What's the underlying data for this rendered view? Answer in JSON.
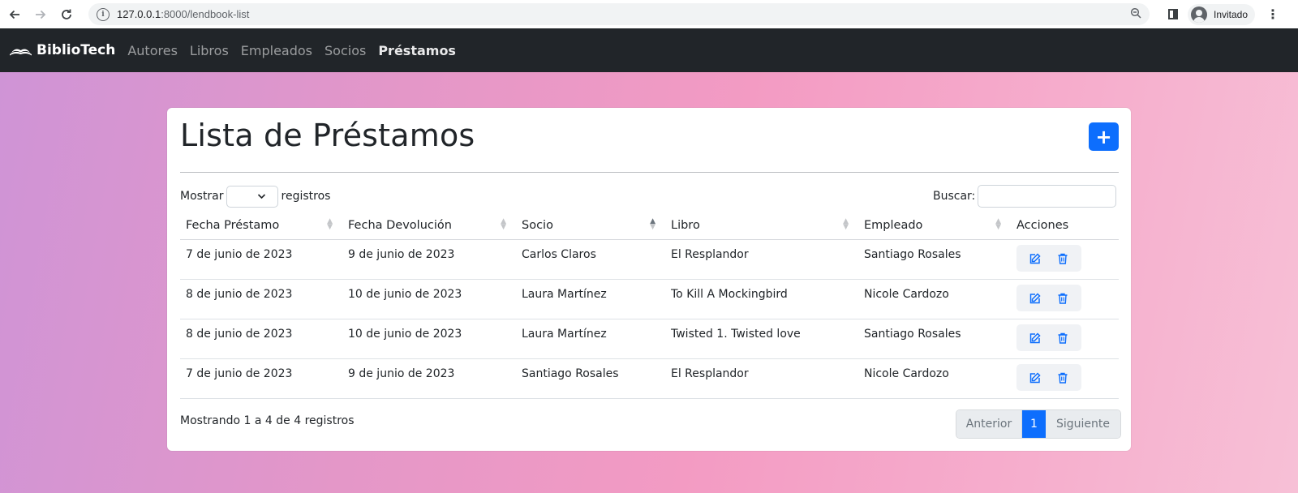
{
  "browser": {
    "url_host": "127.0.0.1",
    "url_rest": ":8000/lendbook-list",
    "profile_label": "Invitado"
  },
  "navbar": {
    "brand": "BiblioTech",
    "links": [
      "Autores",
      "Libros",
      "Empleados",
      "Socios",
      "Préstamos"
    ],
    "active": "Préstamos"
  },
  "page": {
    "title": "Lista de Préstamos",
    "add_label": "+",
    "length_prefix": "Mostrar",
    "length_suffix": "registros",
    "length_value": "",
    "search_label": "Buscar:",
    "search_value": "",
    "info": "Mostrando 1 a 4 de 4 registros"
  },
  "table": {
    "headers": [
      "Fecha Préstamo",
      "Fecha Devolución",
      "Socio",
      "Libro",
      "Empleado",
      "Acciones"
    ],
    "sorted_column": "Socio",
    "rows": [
      [
        "7 de junio de 2023",
        "9 de junio de 2023",
        "Carlos Claros",
        "El Resplandor",
        "Santiago Rosales"
      ],
      [
        "8 de junio de 2023",
        "10 de junio de 2023",
        "Laura Martínez",
        "To Kill A Mockingbird",
        "Nicole Cardozo"
      ],
      [
        "8 de junio de 2023",
        "10 de junio de 2023",
        "Laura Martínez",
        "Twisted 1. Twisted love",
        "Santiago Rosales"
      ],
      [
        "7 de junio de 2023",
        "9 de junio de 2023",
        "Santiago Rosales",
        "El Resplandor",
        "Nicole Cardozo"
      ]
    ],
    "row_icons": [
      "edit-icon",
      "trash-icon"
    ]
  },
  "pagination": {
    "prev": "Anterior",
    "current": "1",
    "next": "Siguiente"
  },
  "colors": {
    "primary": "#0d6efd",
    "navbar": "#212529"
  }
}
